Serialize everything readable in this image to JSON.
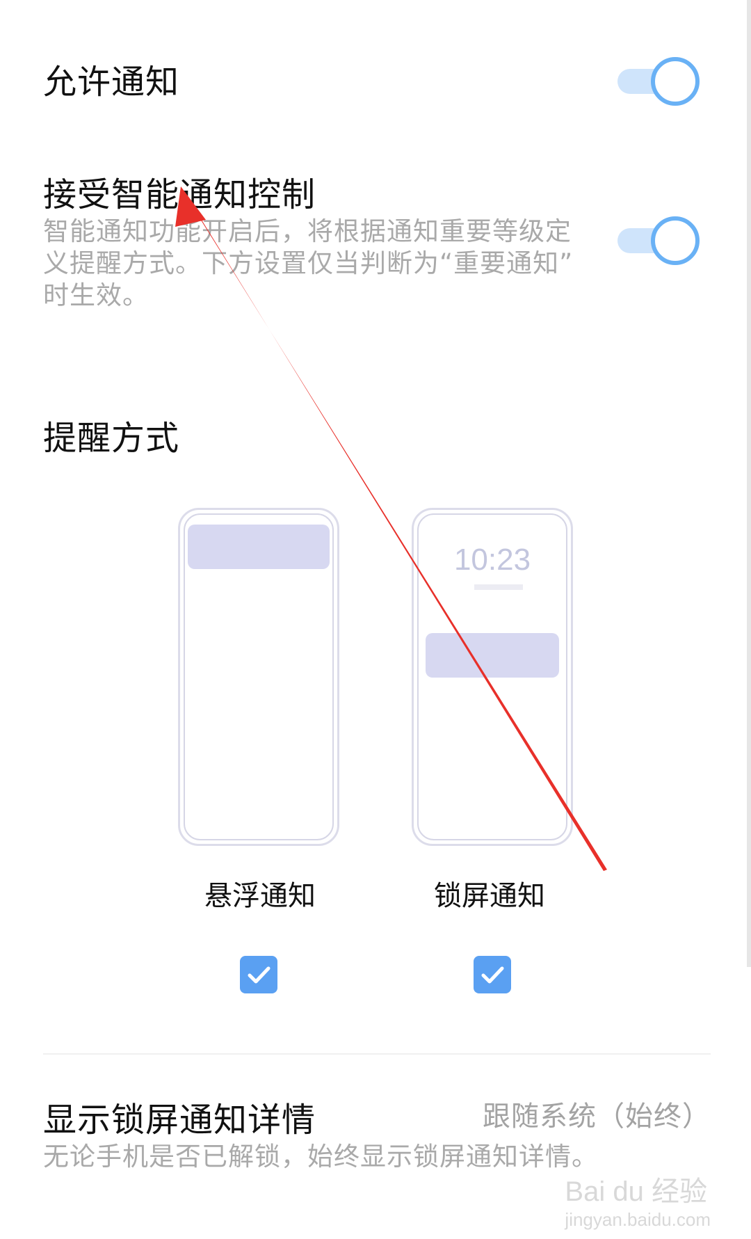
{
  "settings": {
    "allow_notifications": {
      "title": "允许通知",
      "enabled": true
    },
    "smart_control": {
      "title": "接受智能通知控制",
      "description_lines": [
        "智能通知功能开启后，将根据通知重要等级定",
        "义提醒方式。下方设置仅当判断为“重要通知”",
        "时生效。"
      ],
      "enabled": true
    },
    "reminder_section": {
      "title": "提醒方式"
    },
    "modes": [
      {
        "label": "悬浮通知",
        "checked": true
      },
      {
        "label": "锁屏通知",
        "checked": true,
        "preview_time": "10:23"
      }
    ],
    "lockscreen_details": {
      "title": "显示锁屏通知详情",
      "value": "跟随系统（始终）",
      "description": "无论手机是否已解锁，始终显示锁屏通知详情。"
    }
  },
  "watermark": {
    "logo_text": "Bai du 经验",
    "domain": "jingyan.baidu.com"
  },
  "colors": {
    "accent": "#5aa0f2",
    "toggle_track": "#cfe4fb",
    "annotation_arrow": "#e8302a"
  }
}
